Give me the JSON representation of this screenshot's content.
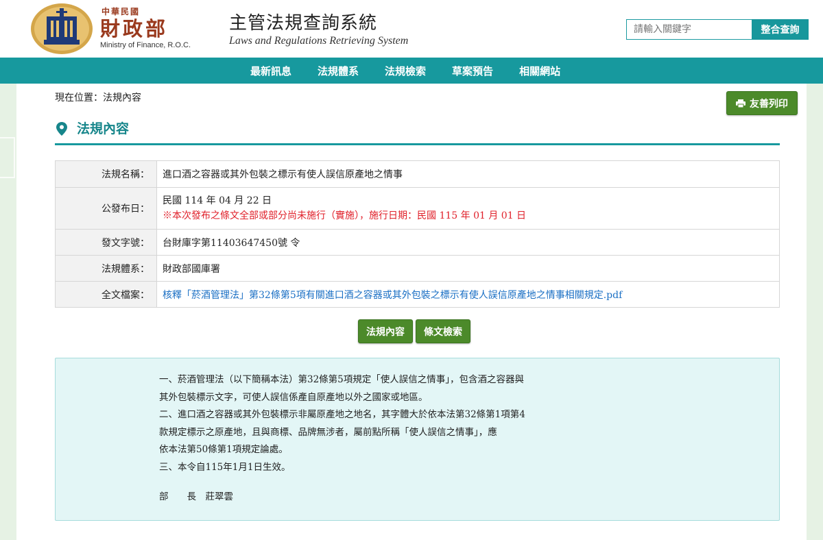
{
  "header": {
    "org_small": "中華民國",
    "org_name": "財政部",
    "org_en": "Ministry of Finance, R.O.C.",
    "system_title": "主管法規查詢系統",
    "system_en": "Laws and Regulations Retrieving System",
    "search_placeholder": "請輸入關鍵字",
    "search_button": "整合查詢"
  },
  "nav": [
    "最新訊息",
    "法規體系",
    "法規檢索",
    "草案預告",
    "相關網站"
  ],
  "breadcrumb": "現在位置：法規內容",
  "print_button": "友善列印",
  "section_title": "法規內容",
  "info": {
    "name_label": "法規名稱：",
    "name_value": "進口酒之容器或其外包裝之標示有使人誤信原產地之情事",
    "date_label": "公發布日：",
    "date_value": "民國 114 年 04 月 22 日",
    "date_note": "※本次發布之條文全部或部分尚未施行（實施），施行日期：民國 115 年 01 月 01 日",
    "doc_label": "發文字號：",
    "doc_value": "台財庫字第11403647450號 令",
    "system_label": "法規體系：",
    "system_value": "財政部國庫署",
    "file_label": "全文檔案：",
    "file_value": "核釋「菸酒管理法」第32條第5項有關進口酒之容器或其外包裝之標示有使人誤信原產地之情事相關規定.pdf"
  },
  "buttons": {
    "content": "法規內容",
    "article_search": "條文檢索"
  },
  "content": {
    "lines": [
      "一、菸酒管理法（以下簡稱本法）第32條第5項規定「使人誤信之情事」，包含酒之容器與",
      "其外包裝標示文字，可使人誤信係產自原產地以外之國家或地區。",
      "二、進口酒之容器或其外包裝標示非屬原產地之地名，其字體大於依本法第32條第1項第4",
      "款規定標示之原產地，且與商標、品牌無涉者，屬前點所稱「使人誤信之情事」，應",
      "依本法第50條第1項規定論處。",
      "三、本令自115年1月1日生效。"
    ],
    "signature": "部　　長　莊翠雲"
  },
  "colors": {
    "teal": "#17999e",
    "green_button": "#4c8a2a",
    "red_note": "#e0202a",
    "link": "#1a6fc4"
  }
}
